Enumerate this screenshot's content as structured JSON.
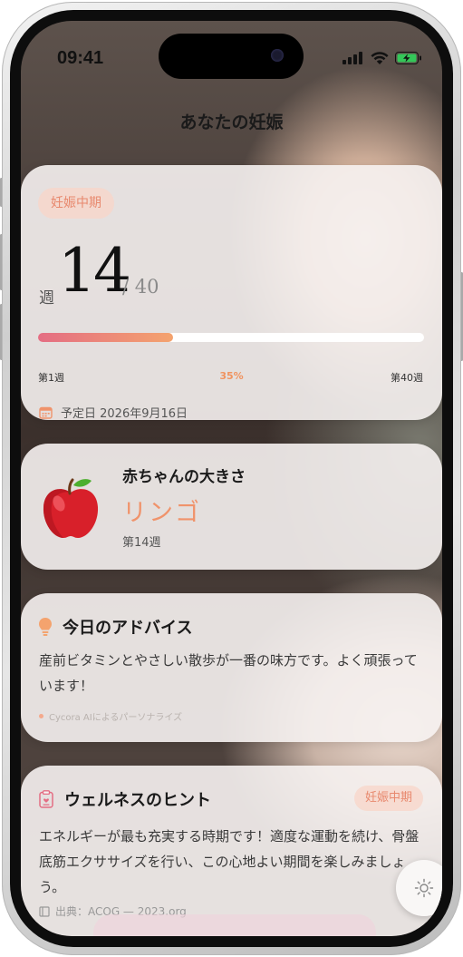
{
  "status": {
    "time": "09:41"
  },
  "page": {
    "title": "あなたの妊娠"
  },
  "progress": {
    "trimester_badge": "妊娠中期",
    "week_prefix": "週",
    "week": "14",
    "week_total": "/ 40",
    "percent": "35%",
    "percent_value": 0.35,
    "start_label": "第1週",
    "end_label": "第40週",
    "due_date": "予定日 2026年9月16日"
  },
  "baby": {
    "label": "赤ちゃんの大きさ",
    "fruit": "リンゴ",
    "week_label": "第14週"
  },
  "advice": {
    "title": "今日のアドバイス",
    "text": "産前ビタミンとやさしい散歩が一番の味方です。よく頑張っています！",
    "credit": "Cycora AIによるパーソナライズ"
  },
  "wellness": {
    "title": "ウェルネスのヒント",
    "badge": "妊娠中期",
    "text": "エネルギーが最も充実する時期です！適度な運動を続け、骨盤底筋エクササイズを行い、この心地よい期間を楽しみましょう。",
    "source": "出典：ACOG — 2023.org"
  },
  "colors": {
    "accent": "#f0936b",
    "progress_start": "#e46d83",
    "progress_end": "#f4a36e"
  }
}
